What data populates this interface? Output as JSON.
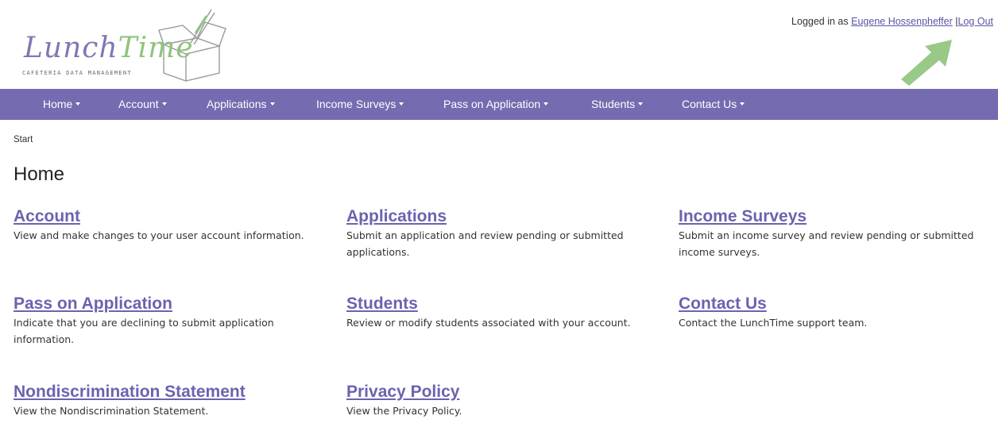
{
  "logo": {
    "name_part1": "Lunch",
    "name_part2": "Time",
    "tagline": "Cafeteria Data Management"
  },
  "login": {
    "prefix": "Logged in as",
    "user": "Eugene Hossenpheffer",
    "separator": "|",
    "logout": "Log Out"
  },
  "nav": [
    {
      "label": "Home"
    },
    {
      "label": "Account"
    },
    {
      "label": "Applications"
    },
    {
      "label": "Income Surveys"
    },
    {
      "label": "Pass on Application"
    },
    {
      "label": "Students"
    },
    {
      "label": "Contact Us"
    }
  ],
  "breadcrumb": "Start",
  "page_title": "Home",
  "sections": [
    {
      "title": "Account",
      "desc": "View and make changes to your user account information."
    },
    {
      "title": "Applications",
      "desc": "Submit an application and review pending or submitted applications."
    },
    {
      "title": "Income Surveys",
      "desc": "Submit an income survey and review pending or submitted income surveys."
    },
    {
      "title": "Pass on Application",
      "desc": "Indicate that you are declining to submit application information."
    },
    {
      "title": "Students",
      "desc": "Review or modify students associated with your account."
    },
    {
      "title": "Contact Us",
      "desc": "Contact the LunchTime support team."
    },
    {
      "title": "Nondiscrimination Statement",
      "desc": "View the Nondiscrimination Statement."
    },
    {
      "title": "Privacy Policy",
      "desc": "View the Privacy Policy."
    }
  ],
  "colors": {
    "nav_bg": "#746bb1",
    "link": "#6a63b0",
    "logo_purple": "#7e78b5",
    "logo_green": "#8fc47d",
    "arrow_green": "#8fc47d"
  }
}
